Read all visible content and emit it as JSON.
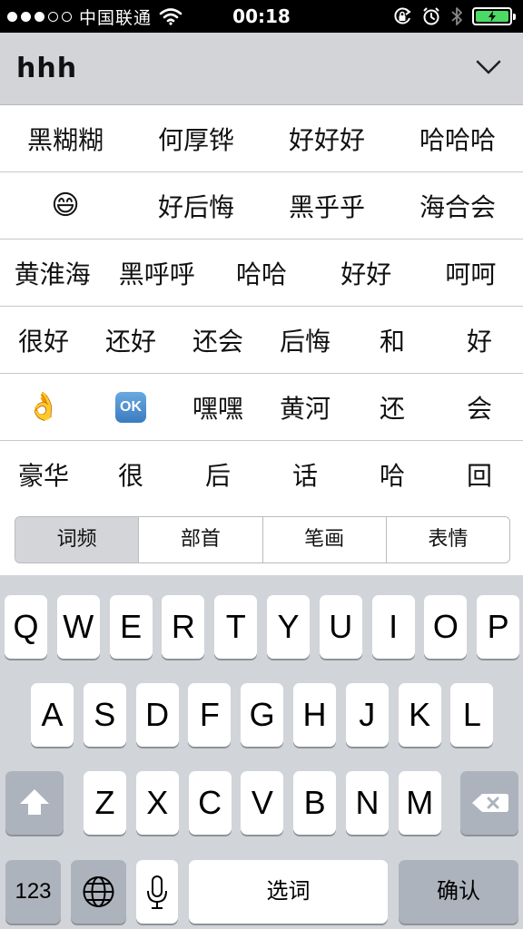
{
  "status_bar": {
    "signal_dots": [
      true,
      true,
      true,
      false,
      false
    ],
    "carrier": "中国联通",
    "time": "00:18",
    "battery_level": 1.0,
    "battery_color": "#4cd964"
  },
  "compose": {
    "text": "hhh"
  },
  "candidates": [
    [
      "黑糊糊",
      "何厚铧",
      "好好好",
      "哈哈哈"
    ],
    [
      "😄",
      "好后悔",
      "黑乎乎",
      "海合会"
    ],
    [
      "黄淮海",
      "黑呼呼",
      "哈哈",
      "好好",
      "呵呵"
    ],
    [
      "很好",
      "还好",
      "还会",
      "后悔",
      "和",
      "好"
    ],
    [
      "👌",
      "OK",
      "嘿嘿",
      "黄河",
      "还",
      "会"
    ],
    [
      "豪华",
      "很",
      "后",
      "话",
      "哈",
      "回"
    ]
  ],
  "segments": [
    {
      "label": "词频",
      "active": true
    },
    {
      "label": "部首",
      "active": false
    },
    {
      "label": "笔画",
      "active": false
    },
    {
      "label": "表情",
      "active": false
    }
  ],
  "keyboard": {
    "row1": [
      "Q",
      "W",
      "E",
      "R",
      "T",
      "Y",
      "U",
      "I",
      "O",
      "P"
    ],
    "row2": [
      "A",
      "S",
      "D",
      "F",
      "G",
      "H",
      "J",
      "K",
      "L"
    ],
    "row3": [
      "Z",
      "X",
      "C",
      "V",
      "B",
      "N",
      "M"
    ],
    "numbers_label": "123",
    "space_label": "选词",
    "confirm_label": "确认",
    "icons": {
      "shift": "shift-icon",
      "delete": "backspace-icon",
      "globe": "globe-icon",
      "mic": "microphone-icon"
    }
  }
}
